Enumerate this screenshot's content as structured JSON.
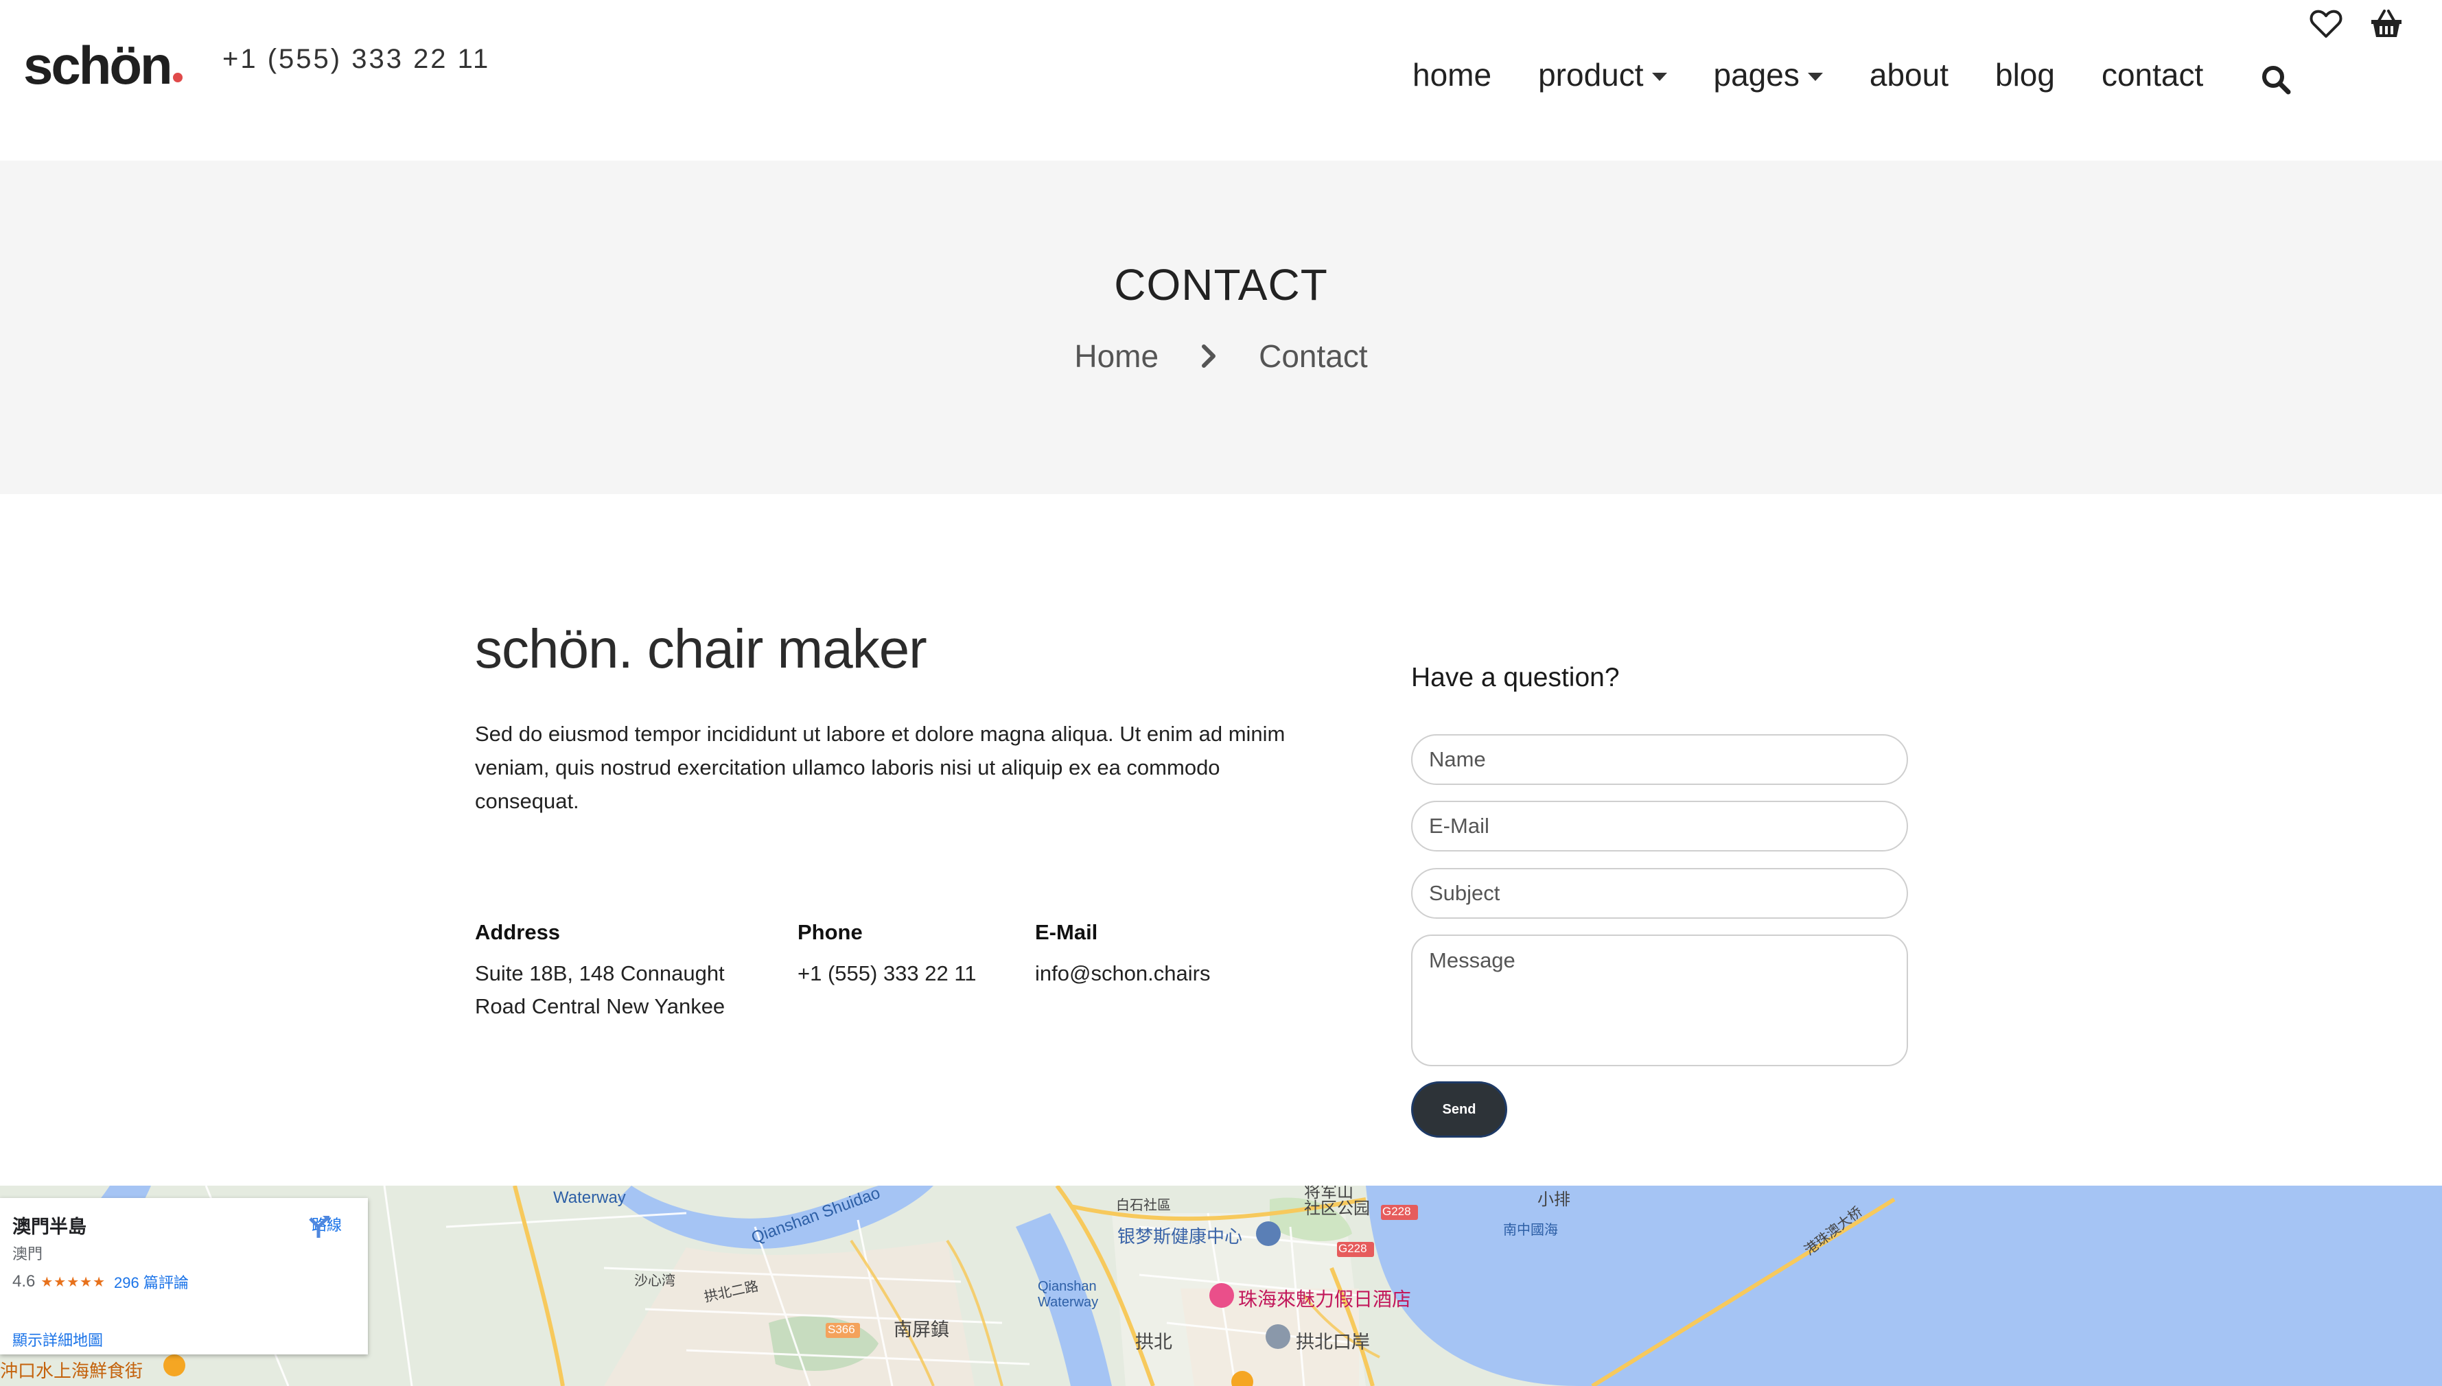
{
  "header": {
    "logo": "schön",
    "phone": "+1 (555) 333 22 11",
    "nav": [
      {
        "label": "home",
        "has_dropdown": false
      },
      {
        "label": "product",
        "has_dropdown": true
      },
      {
        "label": "pages",
        "has_dropdown": true
      },
      {
        "label": "about",
        "has_dropdown": false
      },
      {
        "label": "blog",
        "has_dropdown": false
      },
      {
        "label": "contact",
        "has_dropdown": false
      }
    ],
    "icons": [
      "search-icon",
      "heart-icon",
      "basket-icon"
    ]
  },
  "page_header": {
    "title": "CONTACT",
    "breadcrumb": [
      "Home",
      "Contact"
    ]
  },
  "contact": {
    "company": "schön. chair maker",
    "description": "Sed do eiusmod tempor incididunt ut labore et dolore magna aliqua. Ut enim ad minim veniam, quis nostrud exercitation ullamco laboris nisi ut aliquip ex ea commodo consequat.",
    "address": {
      "label": "Address",
      "line1": "Suite 18B, 148 Connaught",
      "line2": "Road Central New Yankee"
    },
    "phone": {
      "label": "Phone",
      "value": "+1 (555) 333 22 11"
    },
    "email": {
      "label": "E-Mail",
      "value": "info@schon.chairs"
    }
  },
  "form": {
    "title": "Have a question?",
    "name_placeholder": "Name",
    "email_placeholder": "E-Mail",
    "subject_placeholder": "Subject",
    "message_placeholder": "Message",
    "send_label": "Send"
  },
  "map": {
    "card": {
      "title": "澳門半島",
      "subtitle": "澳門",
      "rating": "4.6",
      "stars": "★★★★★",
      "reviews": "296 篇評論",
      "directions": "路線",
      "larger_map": "顯示詳細地圖"
    },
    "labels": {
      "waterway": "Waterway",
      "qianshan_shuidao": "Qianshan Shuidao",
      "qianshan_waterway": "Qianshan\nWaterway",
      "nanping": "南屏鎮",
      "gongbei": "拱北",
      "gongbei_port": "拱北口岸",
      "hotel": "珠海來魅力假日酒店",
      "health_center": "银梦斯健康中心",
      "jiangjunshan": "将军山\n社区公园",
      "xiaopai": "小排",
      "bridge": "港珠澳大桥",
      "nanzhong": "南中國海",
      "seafood_street": "沖口水上海鮮食街",
      "baishi": "白石社區",
      "shapingroad": "沙心湾",
      "road_s366": "S366",
      "road_g228a": "G228",
      "road_g228b": "G228",
      "gongbei_road": "拱北二路"
    },
    "colors": {
      "sea": "#a5c4f4",
      "land": "#e5ebe0",
      "road_major": "#f7c95c",
      "urban": "#efe9df"
    }
  }
}
